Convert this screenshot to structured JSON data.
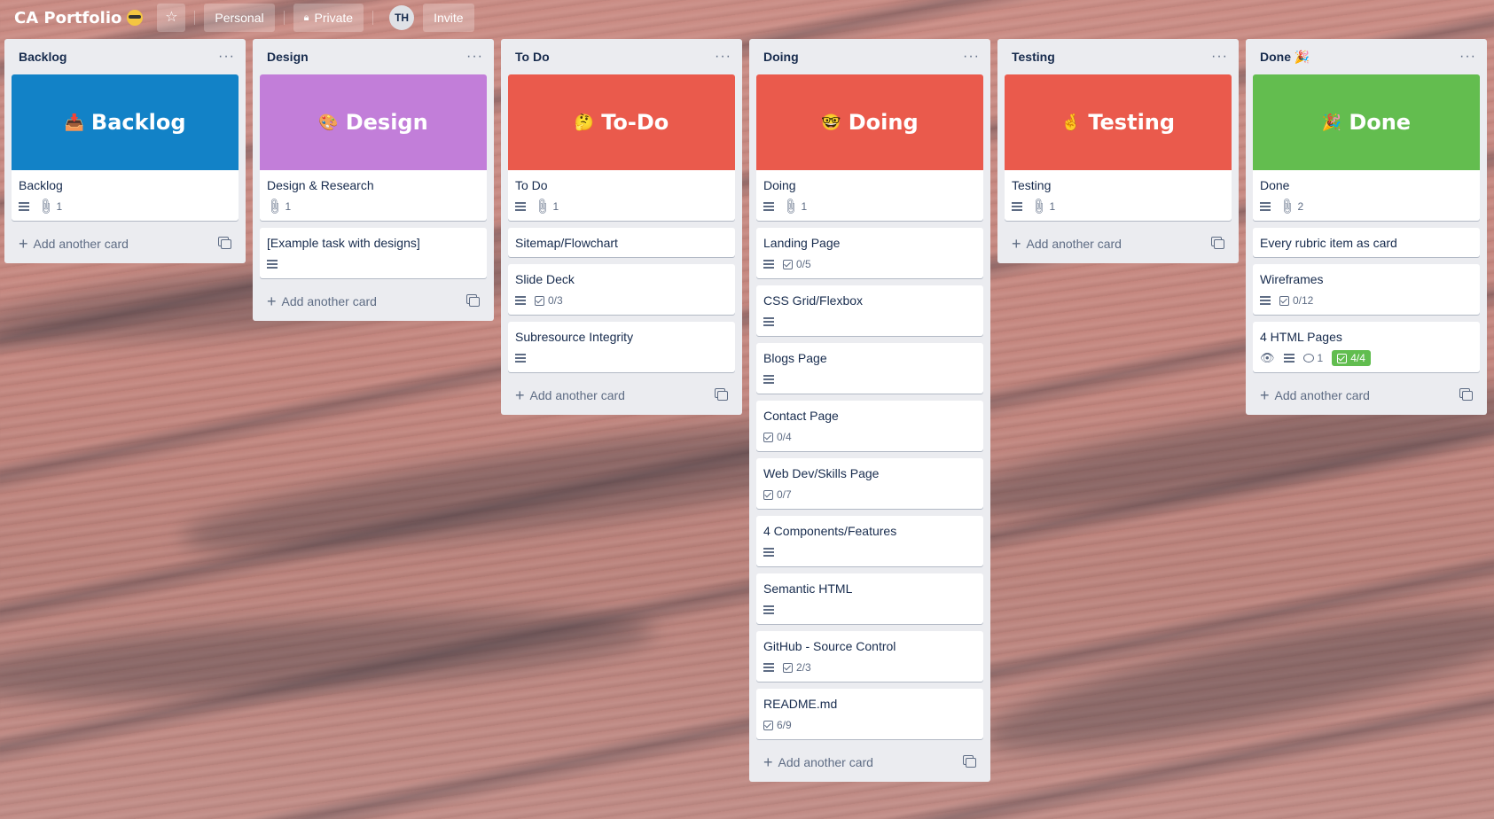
{
  "board": {
    "title": "CA Portfolio",
    "title_emoji": "nerd-face",
    "visibility_team": "Personal",
    "visibility": "Private",
    "member_initials": "TH",
    "invite_label": "Invite"
  },
  "add_card_label": "Add another card",
  "colors": {
    "backlog": "#1282c7",
    "design": "#c27ed9",
    "todo": "#ea5a4c",
    "doing": "#ea5a4c",
    "testing": "#ea5a4c",
    "done": "#63bd4f",
    "checklist_complete": "#61bd4f"
  },
  "lists": [
    {
      "title": "Backlog",
      "cover": {
        "label": "Backlog",
        "emoji": "📥"
      },
      "cards": [
        {
          "title": "Backlog",
          "desc": true,
          "attachments": "1"
        }
      ]
    },
    {
      "title": "Design",
      "cover": {
        "label": "Design",
        "emoji": "🎨"
      },
      "cards": [
        {
          "title": "Design & Research",
          "attachments": "1"
        },
        {
          "title": "[Example task with designs]",
          "desc": true
        }
      ]
    },
    {
      "title": "To Do",
      "cover": {
        "label": "To-Do",
        "emoji": "🤔"
      },
      "cards": [
        {
          "title": "To Do",
          "desc": true,
          "attachments": "1"
        },
        {
          "title": "Sitemap/Flowchart"
        },
        {
          "title": "Slide Deck",
          "desc": true,
          "checklist": "0/3"
        },
        {
          "title": "Subresource Integrity",
          "desc": true
        }
      ]
    },
    {
      "title": "Doing",
      "cover": {
        "label": "Doing",
        "emoji": "🤓"
      },
      "cards": [
        {
          "title": "Doing",
          "desc": true,
          "attachments": "1"
        },
        {
          "title": "Landing Page",
          "desc": true,
          "checklist": "0/5"
        },
        {
          "title": "CSS Grid/Flexbox",
          "desc": true
        },
        {
          "title": "Blogs Page",
          "desc": true
        },
        {
          "title": "Contact Page",
          "checklist": "0/4"
        },
        {
          "title": "Web Dev/Skills Page",
          "checklist": "0/7"
        },
        {
          "title": "4 Components/Features",
          "desc": true
        },
        {
          "title": "Semantic HTML",
          "desc": true
        },
        {
          "title": "GitHub - Source Control",
          "desc": true,
          "checklist": "2/3"
        },
        {
          "title": "README.md",
          "checklist": "6/9"
        }
      ]
    },
    {
      "title": "Testing",
      "cover": {
        "label": "Testing",
        "emoji": "🤞"
      },
      "cards": [
        {
          "title": "Testing",
          "desc": true,
          "attachments": "1"
        }
      ]
    },
    {
      "title": "Done 🎉",
      "cover": {
        "label": "Done",
        "emoji": "🎉"
      },
      "cards": [
        {
          "title": "Done",
          "desc": true,
          "attachments": "2"
        },
        {
          "title": "Every rubric item as card"
        },
        {
          "title": "Wireframes",
          "desc": true,
          "checklist": "0/12"
        },
        {
          "title": "4 HTML Pages",
          "watch": true,
          "desc": true,
          "comments": "1",
          "checklist_done": "4/4"
        }
      ]
    }
  ]
}
